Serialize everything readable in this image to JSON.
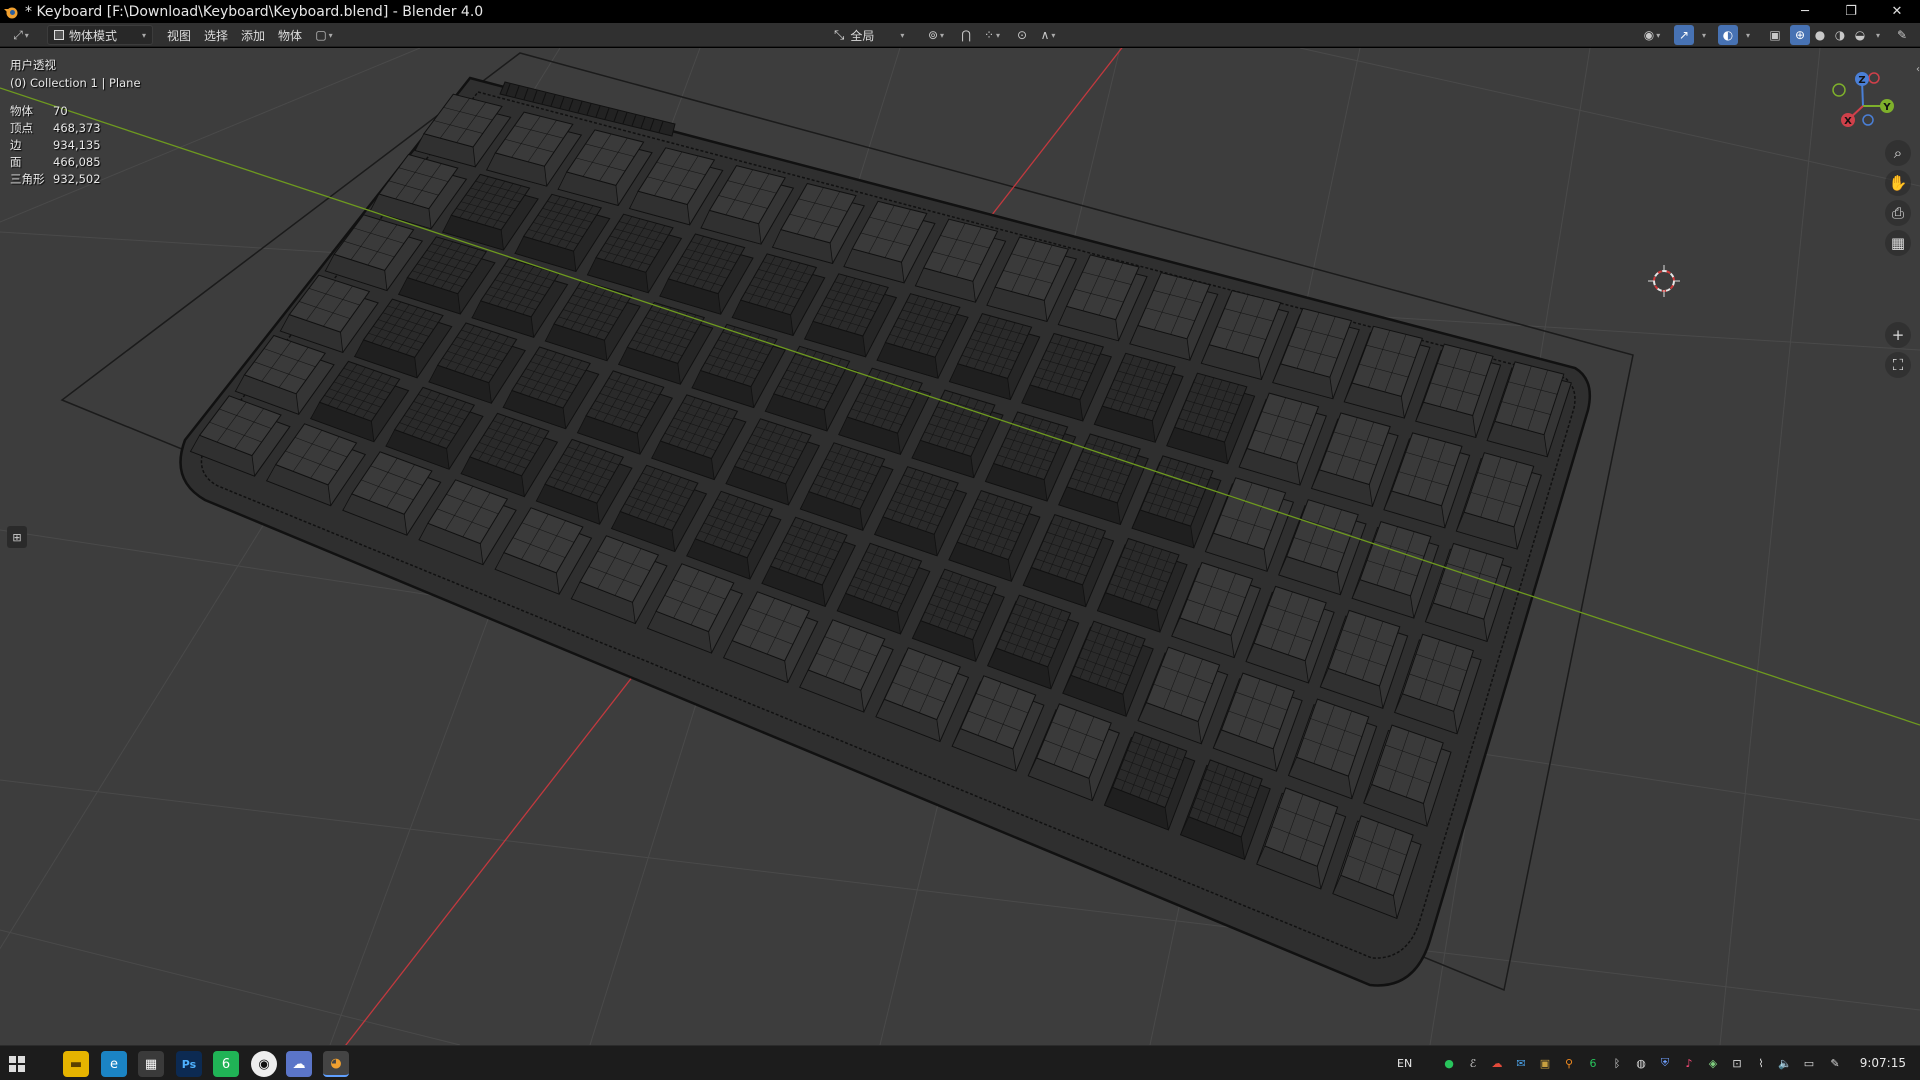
{
  "window": {
    "title": "* Keyboard [F:\\Download\\Keyboard\\Keyboard.blend] - Blender 4.0",
    "minimize": "─",
    "restore": "❐",
    "close": "✕"
  },
  "header": {
    "editor_type_icon": "transform-icon",
    "mode": "物体模式",
    "menus": [
      "视图",
      "选择",
      "添加",
      "物体"
    ],
    "transform_orientation": "全局"
  },
  "viewport": {
    "view_name": "用户透视",
    "collection": "(0) Collection 1 | Plane",
    "stats": [
      {
        "label": "物体",
        "value": "70"
      },
      {
        "label": "顶点",
        "value": "468,373"
      },
      {
        "label": "边",
        "value": "934,135"
      },
      {
        "label": "面",
        "value": "466,085"
      },
      {
        "label": "三角形",
        "value": "932,502"
      }
    ],
    "gizmo_axes": {
      "x": "X",
      "y": "Y",
      "z": "Z"
    },
    "colors": {
      "background": "#3d3d3d",
      "grid": "#4a4a4a",
      "x_axis": "#c2393e",
      "y_axis": "#6e9a1f",
      "wire": "#111111"
    }
  },
  "taskbar": {
    "language": "EN",
    "clock": "9:07:15"
  }
}
